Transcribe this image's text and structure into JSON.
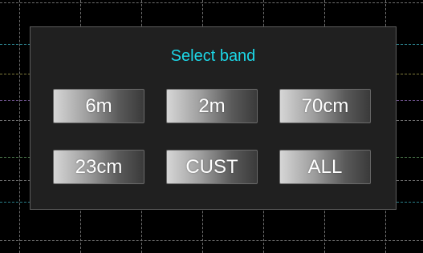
{
  "dialog": {
    "title": "Select band",
    "title_color": "#1cd7e7",
    "bands": [
      "6m",
      "2m",
      "70cm",
      "23cm",
      "CUST",
      "ALL"
    ]
  },
  "colors": {
    "background": "#000000",
    "dialog_background": "#202020",
    "dialog_border": "#5e5e5e",
    "button_gradient_light": "#d6d6d6",
    "button_gradient_dark": "#3a3a3a",
    "button_text": "#ffffff"
  }
}
